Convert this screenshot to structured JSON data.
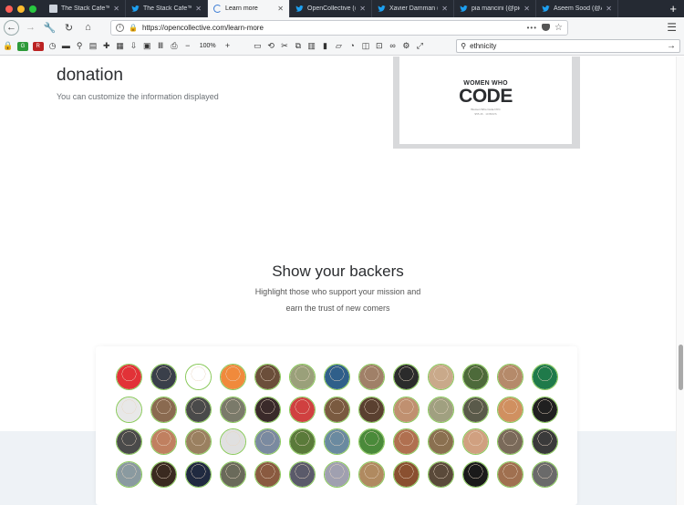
{
  "tabs": [
    {
      "label": "The Stack Cafe™ - ",
      "favicon": "stackcafe-icon",
      "active": false
    },
    {
      "label": "The Stack Cafe™ - ",
      "favicon": "twitter-icon",
      "active": false
    },
    {
      "label": "Learn more",
      "favicon": "loading-icon",
      "active": true
    },
    {
      "label": "OpenCollective (@o",
      "favicon": "twitter-icon",
      "active": false
    },
    {
      "label": "Xavier Damman (@",
      "favicon": "twitter-icon",
      "active": false
    },
    {
      "label": "pia mancini (@pion",
      "favicon": "twitter-icon",
      "active": false
    },
    {
      "label": "Aseem Sood (@Ase",
      "favicon": "twitter-icon",
      "active": false
    }
  ],
  "tab_close_glyph": "✕",
  "new_tab_glyph": "+",
  "nav": {
    "url": "https://opencollective.com/learn-more",
    "page_actions": "•••"
  },
  "toolbar": {
    "zoom": "100%",
    "search_value": "ethnicity"
  },
  "page": {
    "donation_title": "donation",
    "donation_subtitle": "You can customize the information displayed",
    "shot": {
      "line1": "WOMEN WHO",
      "line2": "CODE",
      "small1": "Women Who Code NYC",
      "small2": "$55.46 · 10 BKRS"
    },
    "backers_title": "Show your backers",
    "backers_line1": "Highlight those who support your mission and",
    "backers_line2": "earn the trust of new comers"
  },
  "avatars": [
    "#e23237",
    "#3a3f4a",
    "#ffffff",
    "#f08a3c",
    "#6b4e3a",
    "#9aa07a",
    "#2f5f8a",
    "#a08068",
    "#2b2b2b",
    "#c9a98a",
    "#4d6a3a",
    "#b58a6a",
    "#1f7a4a",
    "#e8e8e8",
    "#8a6a50",
    "#4a4a4a",
    "#7a7a6a",
    "#3a2a2a",
    "#d04040",
    "#7a5a40",
    "#5a4030",
    "#c09070",
    "#a0a080",
    "#5a5a4a",
    "#d09060",
    "#202020",
    "#4a4a4a",
    "#c08060",
    "#9a8060",
    "#e0e0e0",
    "#7a8aa0",
    "#5a7a3a",
    "#6a8aa0",
    "#4a8a3a",
    "#b07050",
    "#8a7050",
    "#d0a080",
    "#7a6a5a",
    "#3a3a3a",
    "#8a9aa0",
    "#3a2a20",
    "#202a40",
    "#6a6a5a",
    "#8a5a40",
    "#5a5a6a",
    "#a0a0b0",
    "#b08a60",
    "#8a5030",
    "#5a4a3a",
    "#1a1a1a",
    "#a07050",
    "#6a6a6a"
  ],
  "colors": {
    "tabstrip": "#252a33",
    "avatar_ring": "#89c95a",
    "band": "#eef2f6"
  }
}
